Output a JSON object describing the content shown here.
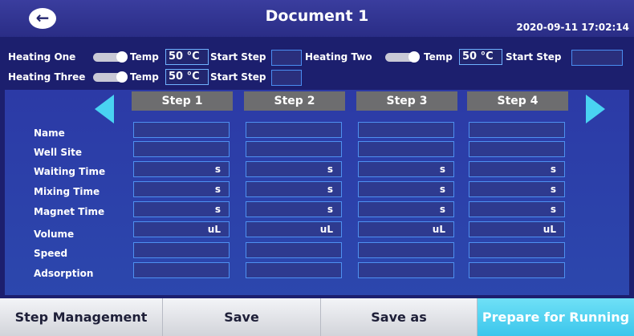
{
  "header": {
    "title": "Document 1",
    "datetime": "2020-09-11 17:02:14"
  },
  "heating": [
    {
      "label": "Heating One",
      "temp_label": "Temp",
      "temp_value": "50 °C",
      "start_step_label": "Start Step",
      "start_step_value": ""
    },
    {
      "label": "Heating Two",
      "temp_label": "Temp",
      "temp_value": "50 °C",
      "start_step_label": "Start Step",
      "start_step_value": ""
    },
    {
      "label": "Heating Three",
      "temp_label": "Temp",
      "temp_value": "50 °C",
      "start_step_label": "Start Step",
      "start_step_value": ""
    }
  ],
  "row_labels": [
    "Name",
    "Well Site",
    "Waiting Time",
    "Mixing Time",
    "Magnet Time",
    "Volume",
    "Speed",
    "Adsorption"
  ],
  "steps": [
    {
      "title": "Step 1",
      "cells": [
        "",
        "",
        "s",
        "s",
        "s",
        "uL",
        "",
        ""
      ]
    },
    {
      "title": "Step 2",
      "cells": [
        "",
        "",
        "s",
        "s",
        "s",
        "uL",
        "",
        ""
      ]
    },
    {
      "title": "Step 3",
      "cells": [
        "",
        "",
        "s",
        "s",
        "s",
        "uL",
        "",
        ""
      ]
    },
    {
      "title": "Step 4",
      "cells": [
        "",
        "",
        "s",
        "s",
        "s",
        "uL",
        "",
        ""
      ]
    }
  ],
  "footer": {
    "step_management": "Step Management",
    "save": "Save",
    "save_as": "Save as",
    "prepare": "Prepare for Running"
  }
}
